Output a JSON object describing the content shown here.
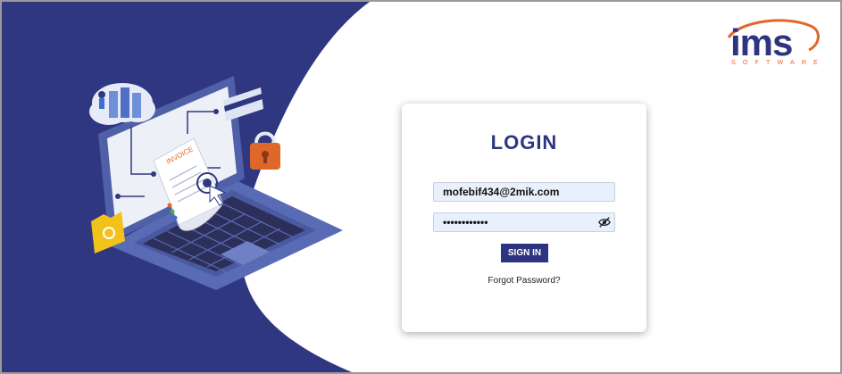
{
  "brand": {
    "logo_text": "ims",
    "logo_subtext": "SOFTWARE"
  },
  "illustration": {
    "invoice_label": "INVOICE"
  },
  "login": {
    "title": "LOGIN",
    "email_value": "mofebif434@2mik.com",
    "password_value": "••••••••••••",
    "sign_in_label": "SIGN IN",
    "forgot_label": "Forgot Password?"
  },
  "icons": {
    "password_toggle": "eye-slash-icon"
  },
  "colors": {
    "brand_navy": "#2e3580",
    "brand_orange": "#e0672a",
    "input_background": "#e8effd"
  }
}
